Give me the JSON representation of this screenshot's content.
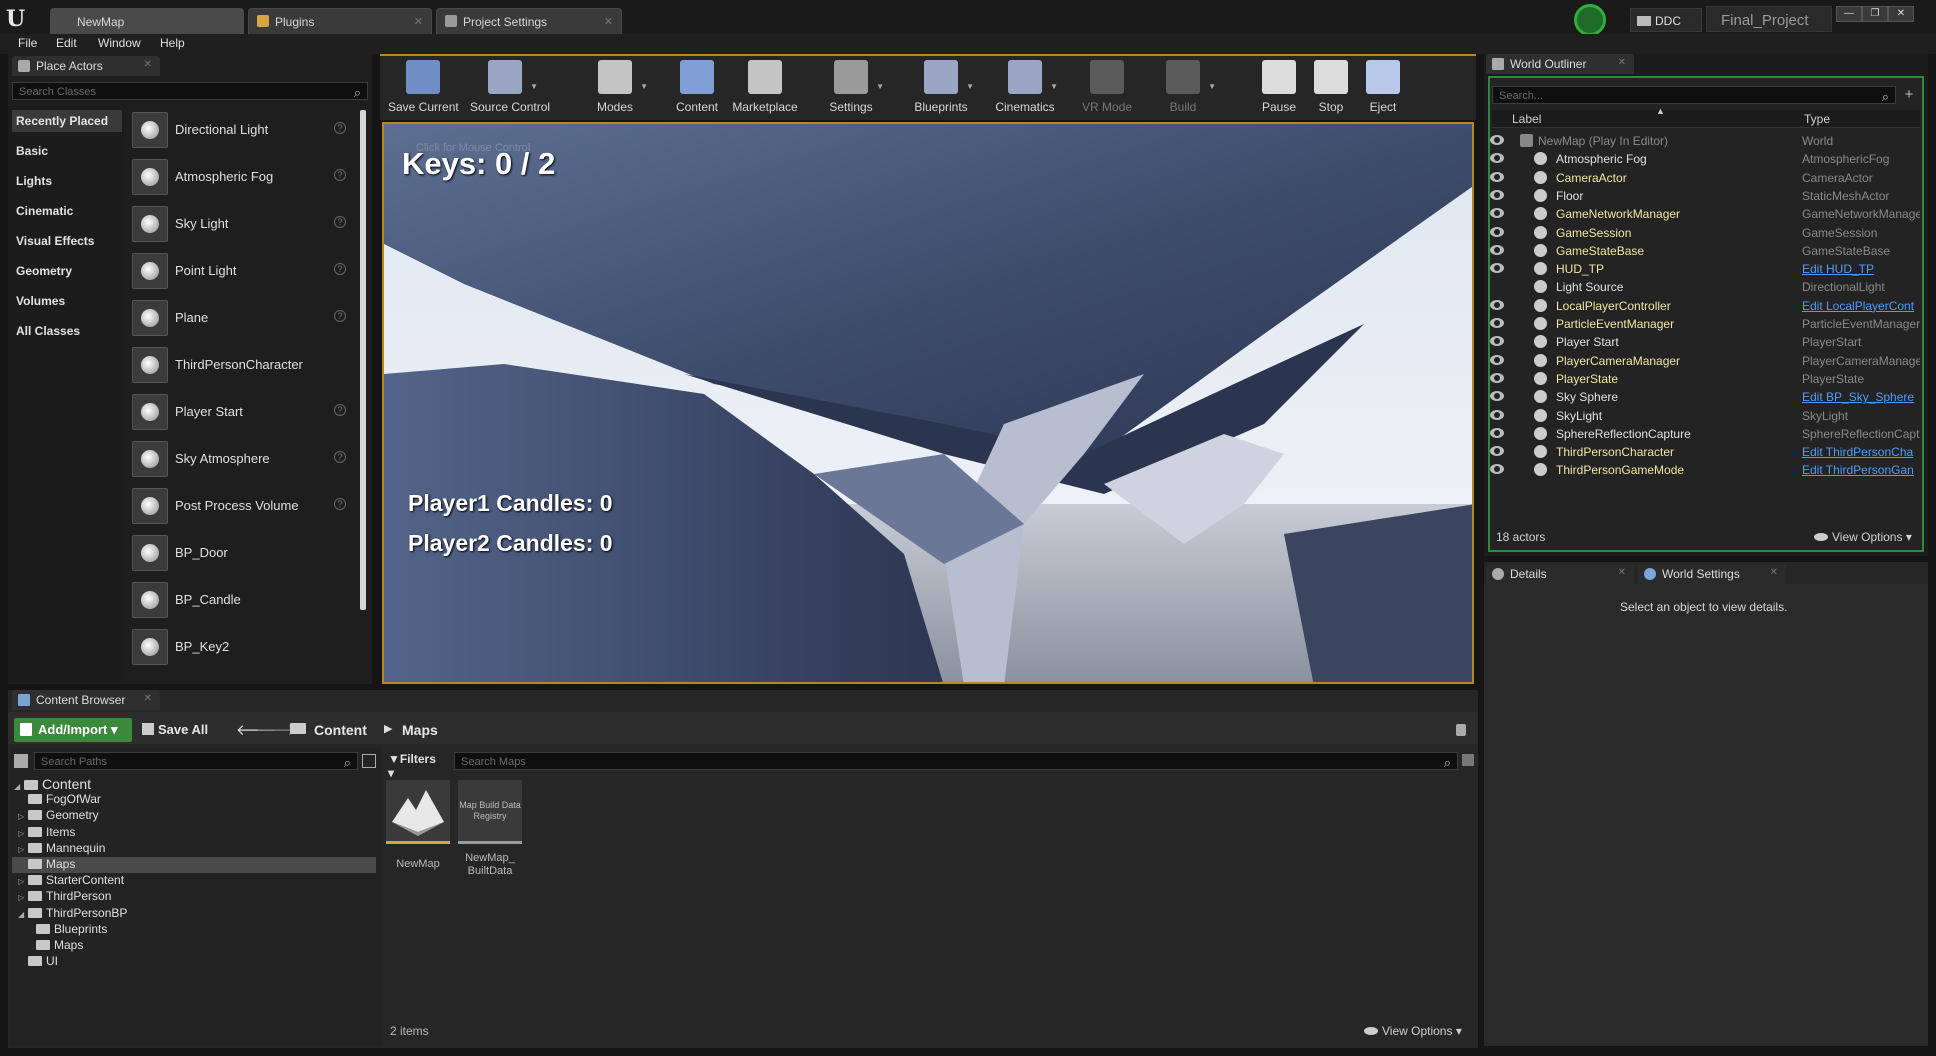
{
  "window": {
    "tabs": [
      {
        "label": "NewMap"
      },
      {
        "label": "Plugins"
      },
      {
        "label": "Project Settings"
      }
    ],
    "ddc_label": "DDC",
    "project_name": "Final_Project",
    "menu": [
      "File",
      "Edit",
      "Window",
      "Help"
    ]
  },
  "place_actors": {
    "tab_label": "Place Actors",
    "search_placeholder": "Search Classes",
    "categories": [
      "Recently Placed",
      "Basic",
      "Lights",
      "Cinematic",
      "Visual Effects",
      "Geometry",
      "Volumes",
      "All Classes"
    ],
    "items": [
      {
        "label": "Directional Light",
        "icon": "directional-light-icon"
      },
      {
        "label": "Atmospheric Fog",
        "icon": "atmospheric-fog-icon"
      },
      {
        "label": "Sky Light",
        "icon": "sky-light-icon"
      },
      {
        "label": "Point Light",
        "icon": "point-light-icon"
      },
      {
        "label": "Plane",
        "icon": "plane-icon"
      },
      {
        "label": "ThirdPersonCharacter",
        "icon": "character-icon"
      },
      {
        "label": "Player Start",
        "icon": "player-start-icon"
      },
      {
        "label": "Sky Atmosphere",
        "icon": "sky-atmosphere-icon"
      },
      {
        "label": "Post Process Volume",
        "icon": "post-process-icon"
      },
      {
        "label": "BP_Door",
        "icon": "blueprint-icon"
      },
      {
        "label": "BP_Candle",
        "icon": "blueprint-icon"
      },
      {
        "label": "BP_Key2",
        "icon": "blueprint-icon"
      }
    ]
  },
  "toolbar": {
    "items": [
      {
        "label": "Save Current"
      },
      {
        "label": "Source Control"
      },
      {
        "label": "Modes"
      },
      {
        "label": "Content"
      },
      {
        "label": "Marketplace"
      },
      {
        "label": "Settings"
      },
      {
        "label": "Blueprints"
      },
      {
        "label": "Cinematics"
      },
      {
        "label": "VR Mode"
      },
      {
        "label": "Build"
      },
      {
        "label": "Pause"
      },
      {
        "label": "Stop"
      },
      {
        "label": "Eject"
      }
    ]
  },
  "viewport": {
    "keys_text": "Keys: 0 / 2",
    "player1_text": "Player1 Candles: 0",
    "player2_text": "Player2 Candles: 0",
    "overlay_hint": "Click for Mouse Control"
  },
  "world_outliner": {
    "tab_label": "World Outliner",
    "search_placeholder": "Search...",
    "col_label": "Label",
    "col_type": "Type",
    "rows": [
      {
        "label": "NewMap (Play In Editor)",
        "type": "World",
        "style": "g",
        "link": false
      },
      {
        "label": "Atmospheric Fog",
        "type": "AtmosphericFog",
        "style": "w",
        "link": false
      },
      {
        "label": "CameraActor",
        "type": "CameraActor",
        "style": "y",
        "link": false
      },
      {
        "label": "Floor",
        "type": "StaticMeshActor",
        "style": "w",
        "link": false
      },
      {
        "label": "GameNetworkManager",
        "type": "GameNetworkManage",
        "style": "y",
        "link": false
      },
      {
        "label": "GameSession",
        "type": "GameSession",
        "style": "y",
        "link": false
      },
      {
        "label": "GameStateBase",
        "type": "GameStateBase",
        "style": "y",
        "link": false
      },
      {
        "label": "HUD_TP",
        "type": "Edit HUD_TP",
        "style": "y",
        "link": true
      },
      {
        "label": "Light Source",
        "type": "DirectionalLight",
        "style": "w",
        "link": false
      },
      {
        "label": "LocalPlayerController",
        "type": "Edit LocalPlayerCont",
        "style": "y",
        "link": true
      },
      {
        "label": "ParticleEventManager",
        "type": "ParticleEventManager",
        "style": "y",
        "link": false
      },
      {
        "label": "Player Start",
        "type": "PlayerStart",
        "style": "w",
        "link": false
      },
      {
        "label": "PlayerCameraManager",
        "type": "PlayerCameraManage",
        "style": "y",
        "link": false
      },
      {
        "label": "PlayerState",
        "type": "PlayerState",
        "style": "y",
        "link": false
      },
      {
        "label": "Sky Sphere",
        "type": "Edit BP_Sky_Sphere",
        "style": "w",
        "link": true
      },
      {
        "label": "SkyLight",
        "type": "SkyLight",
        "style": "w",
        "link": false
      },
      {
        "label": "SphereReflectionCapture",
        "type": "SphereReflectionCaptu",
        "style": "w",
        "link": false
      },
      {
        "label": "ThirdPersonCharacter",
        "type": "Edit ThirdPersonCha",
        "style": "y",
        "link": true
      },
      {
        "label": "ThirdPersonGameMode",
        "type": "Edit ThirdPersonGan",
        "style": "y",
        "link": true
      }
    ],
    "actor_count": "18 actors",
    "view_options": "View Options"
  },
  "details": {
    "tab_details": "Details",
    "tab_world_settings": "World Settings",
    "empty_text": "Select an object to view details."
  },
  "content_browser": {
    "tab_label": "Content Browser",
    "add_import": "Add/Import",
    "save_all": "Save All",
    "breadcrumb": [
      "Content",
      "Maps"
    ],
    "search_paths_placeholder": "Search Paths",
    "filters_label": "Filters",
    "search_maps_placeholder": "Search Maps",
    "tree": [
      {
        "label": "Content",
        "level": 0,
        "expand": "open"
      },
      {
        "label": "FogOfWar",
        "level": 1,
        "expand": "none"
      },
      {
        "label": "Geometry",
        "level": 1,
        "expand": "closed"
      },
      {
        "label": "Items",
        "level": 1,
        "expand": "closed"
      },
      {
        "label": "Mannequin",
        "level": 1,
        "expand": "closed"
      },
      {
        "label": "Maps",
        "level": 1,
        "expand": "none",
        "selected": true
      },
      {
        "label": "StarterContent",
        "level": 1,
        "expand": "closed"
      },
      {
        "label": "ThirdPerson",
        "level": 1,
        "expand": "closed"
      },
      {
        "label": "ThirdPersonBP",
        "level": 1,
        "expand": "open"
      },
      {
        "label": "Blueprints",
        "level": 2,
        "expand": "none"
      },
      {
        "label": "Maps",
        "level": 2,
        "expand": "none"
      },
      {
        "label": "UI",
        "level": 1,
        "expand": "none"
      }
    ],
    "assets": [
      {
        "label": "NewMap",
        "thumb_text": ""
      },
      {
        "label": "NewMap_ BuiltData",
        "thumb_text": "Map Build Data Registry"
      }
    ],
    "item_count": "2 items",
    "view_options": "View Options"
  }
}
